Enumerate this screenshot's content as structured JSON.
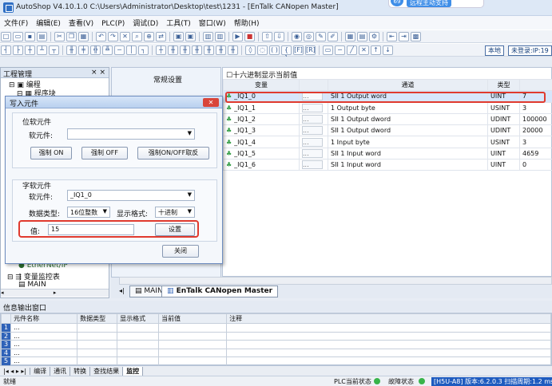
{
  "title": "AutoShop V4.10.1.0  C:\\Users\\Administrator\\Desktop\\test\\1231 - [EnTalk CANopen Master]",
  "banner": {
    "badge": "69",
    "text": "远程主动支持"
  },
  "menu": [
    "文件(F)",
    "编辑(E)",
    "查看(V)",
    "PLC(P)",
    "调试(D)",
    "工具(T)",
    "窗口(W)",
    "帮助(H)"
  ],
  "toolbar1_icons": [
    "new-icon",
    "open-icon",
    "save-icon",
    "print-icon",
    "cut-icon",
    "copy-icon",
    "paste-icon",
    "undo-icon",
    "redo-icon",
    "delete-icon",
    "find-icon",
    "zoom-icon",
    "replace-icon",
    "window-icon",
    "window2-icon",
    "doc-icon",
    "doc2-icon",
    "run-icon",
    "stop-icon",
    "upload-icon",
    "download-icon",
    "monitor-icon",
    "monitor2-icon",
    "edit-icon",
    "write-icon",
    "register-icon",
    "table-icon",
    "config-icon",
    "tool-icon",
    "back-icon",
    "forward-icon",
    "grid-icon"
  ],
  "toolbar2": {
    "local_btn": "本地",
    "login_btn": "未登录:IP:19"
  },
  "left_panel": {
    "title": "工程管理",
    "close": "× ×",
    "tree": [
      "编程",
      "程序块"
    ],
    "tree_bottom": [
      "EtherNet/IP",
      "变量监控表",
      "MAIN"
    ]
  },
  "side_panel": {
    "label": "常规设置"
  },
  "main": {
    "checkbox_label": "十六进制显示当前值",
    "columns": [
      "变量",
      "",
      "通道",
      "类型",
      ""
    ],
    "rows": [
      {
        "var": "_IQ1_0",
        "channel": "SII 1 Output word",
        "type": "UINT",
        "value": "7"
      },
      {
        "var": "_IQ1_1",
        "channel": "1 Output byte",
        "type": "USINT",
        "value": "3"
      },
      {
        "var": "_IQ1_2",
        "channel": "SII 1 Output dword",
        "type": "UDINT",
        "value": "100000"
      },
      {
        "var": "_IQ1_3",
        "channel": "SII 1 Output dword",
        "type": "UDINT",
        "value": "20000"
      },
      {
        "var": "_IQ1_4",
        "channel": "1 Input byte",
        "type": "USINT",
        "value": "3"
      },
      {
        "var": "_IQ1_5",
        "channel": "SII 1 Input word",
        "type": "UINT",
        "value": "4659"
      },
      {
        "var": "_IQ1_6",
        "channel": "SII 1 Input word",
        "type": "UINT",
        "value": "0"
      }
    ],
    "dots": "..."
  },
  "tabs": {
    "main": "MAIN",
    "active": "EnTalk CANopen Master"
  },
  "dialog": {
    "title": "写入元件",
    "close": "✕",
    "bit_group": "位软元件",
    "bit_label": "软元件:",
    "bit_value": "",
    "btn_on": "强制 ON",
    "btn_off": "强制 OFF",
    "btn_toggle": "强制ON/OFF取反",
    "word_group": "字软元件",
    "word_label": "软元件:",
    "word_value": "_IQ1_0",
    "dtype_label": "数据类型:",
    "dtype_value": "16位整数",
    "fmt_label": "显示格式:",
    "fmt_value": "十进制",
    "val_label": "值:",
    "val_value": "15",
    "set_btn": "设置",
    "close_btn": "关闭"
  },
  "output": {
    "title": "信息输出窗口",
    "columns": [
      "",
      "元件名称",
      "数据类型",
      "显示格式",
      "当前值",
      "注释"
    ],
    "rows": [
      "1",
      "2",
      "3",
      "4",
      "5"
    ],
    "dots": "..."
  },
  "bottom_tabs": [
    "编译",
    "通讯",
    "转换",
    "查找结果",
    "监控"
  ],
  "status": {
    "ready": "就绪",
    "plc_state": "PLC当前状态",
    "fault_state": "故障状态",
    "version": "[H5U-A8] 版本:6.2.0.3 扫描周期:1.2 ms"
  }
}
